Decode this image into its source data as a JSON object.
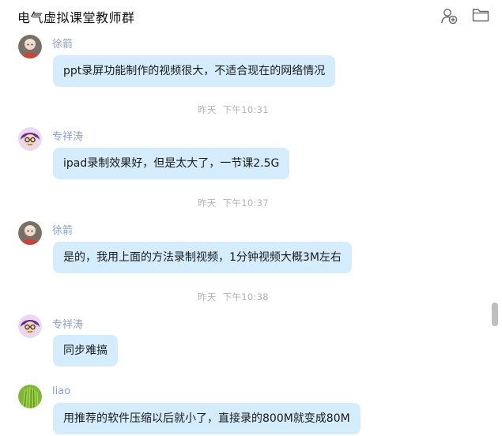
{
  "header": {
    "title": "电气虚拟课堂教师群",
    "add_member_icon": "add-person-icon",
    "folder_icon": "folder-icon"
  },
  "messages": [
    {
      "sender": "徐箭",
      "text": "ppt录屏功能制作的视频很大，不适合现在的网络情况",
      "avatar": "avatar-xujian"
    },
    {
      "sender": "专祥涛",
      "text": "ipad录制效果好，但是太大了，一节课2.5G",
      "avatar": "avatar-zhuanxiangtao"
    },
    {
      "sender": "徐箭",
      "text": "是的，我用上面的方法录制视频，1分钟视频大概3M左右",
      "avatar": "avatar-xujian"
    },
    {
      "sender": "专祥涛",
      "text": "同步难搞",
      "avatar": "avatar-zhuanxiangtao"
    },
    {
      "sender": "liao",
      "text": "用推荐的软件压缩以后就小了，直接录的800M就变成80M",
      "avatar": "avatar-liao"
    }
  ],
  "timestamps": [
    {
      "day": "昨天",
      "time": "下午10:31"
    },
    {
      "day": "昨天",
      "time": "下午10:37"
    },
    {
      "day": "昨天",
      "time": "下午10:38"
    }
  ],
  "colors": {
    "bubble": "#d4ecfb",
    "sender_name": "#8a9fbf",
    "timestamp": "#b3b3b3"
  }
}
